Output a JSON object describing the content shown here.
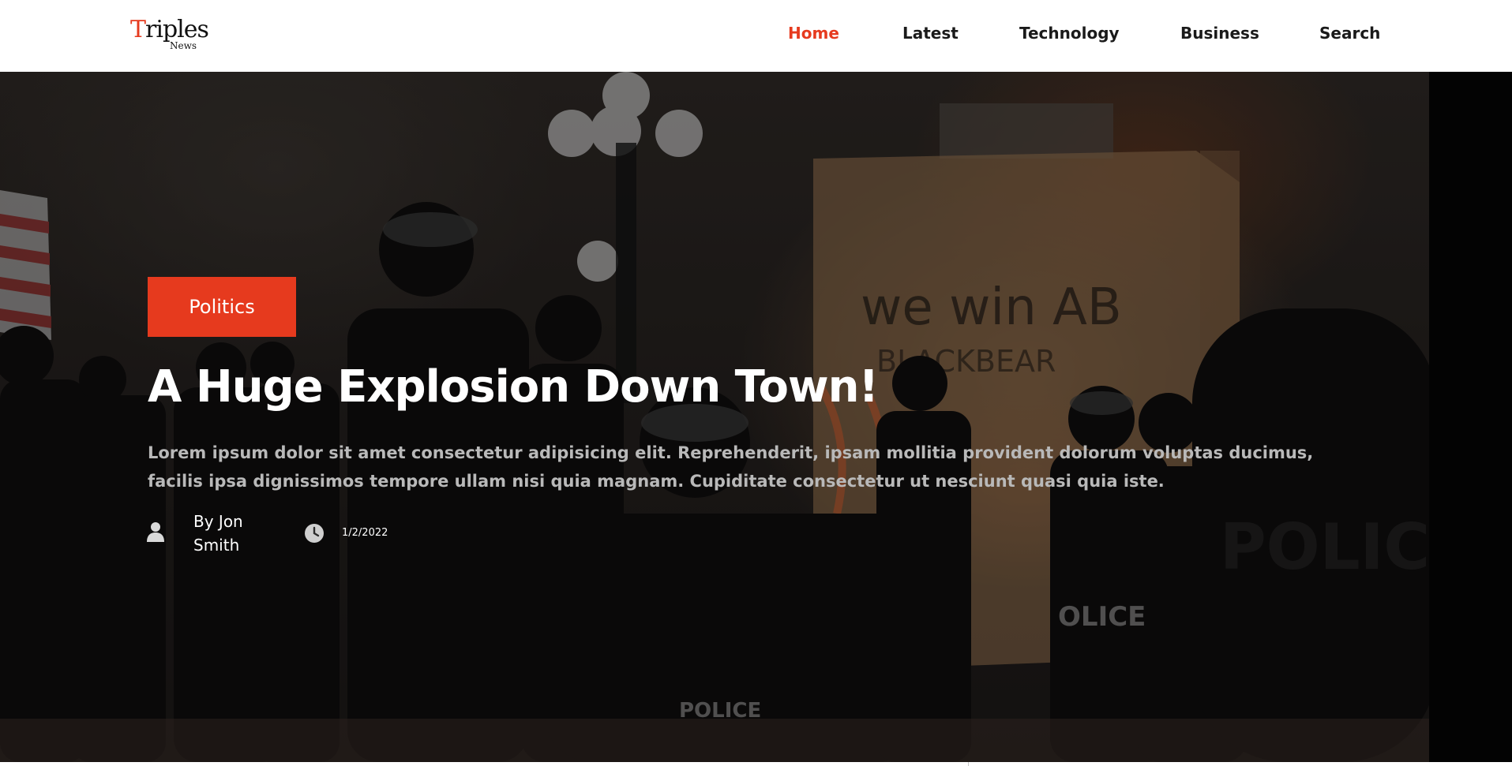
{
  "logo": {
    "first_letter": "T",
    "rest": "riples",
    "sub": "News"
  },
  "nav": {
    "items": [
      {
        "label": "Home",
        "active": true
      },
      {
        "label": "Latest",
        "active": false
      },
      {
        "label": "Technology",
        "active": false
      },
      {
        "label": "Business",
        "active": false
      },
      {
        "label": "Search",
        "active": false
      }
    ]
  },
  "hero": {
    "category": "Politics",
    "title": "A Huge Explosion Down Town!",
    "excerpt": "Lorem ipsum dolor sit amet consectetur adipisicing elit. Reprehenderit, ipsam mollitia provident dolorum voluptas ducimus, facilis ipsa dignissimos tempore ullam nisi quia magnam. Cupiditate consectetur ut nesciunt quasi quia iste.",
    "author": "By Jon Smith",
    "date": "1/2/2022",
    "author_icon": "user-icon",
    "date_icon": "clock-icon"
  },
  "colors": {
    "accent": "#e63a1e",
    "nav_text": "#1a1a1a",
    "excerpt_text": "#b9b9b9"
  }
}
